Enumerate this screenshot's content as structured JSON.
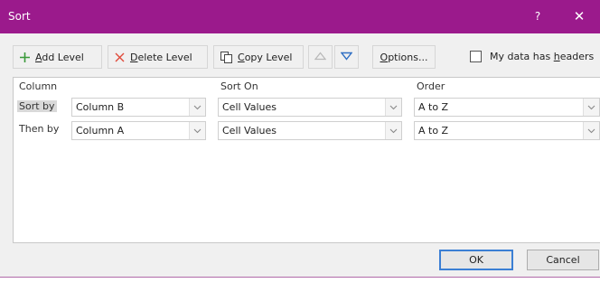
{
  "window": {
    "title": "Sort",
    "help_glyph": "?",
    "close_glyph": "✕",
    "titlebar_color": "#9b1a8c"
  },
  "toolbar": {
    "add_level": {
      "icon": "plus-icon",
      "pre": "",
      "key": "A",
      "post": "dd Level"
    },
    "delete_level": {
      "icon": "delete-x-icon",
      "pre": "",
      "key": "D",
      "post": "elete Level"
    },
    "copy_level": {
      "icon": "copy-icon",
      "pre": "",
      "key": "C",
      "post": "opy Level"
    },
    "move_up": {
      "icon": "triangle-up-icon"
    },
    "move_down": {
      "icon": "triangle-down-icon"
    },
    "options": {
      "pre": "",
      "key": "O",
      "post": "ptions..."
    },
    "my_data_has_headers": {
      "pre": "My data has ",
      "key": "h",
      "post": "eaders",
      "checked": false
    }
  },
  "grid": {
    "headers": {
      "column": "Column",
      "sort_on": "Sort On",
      "order": "Order"
    },
    "rows": [
      {
        "label": "Sort by",
        "column": "Column B",
        "sort_on": "Cell Values",
        "order": "A to Z",
        "selected": true
      },
      {
        "label": "Then by",
        "column": "Column A",
        "sort_on": "Cell Values",
        "order": "A to Z",
        "selected": false
      }
    ]
  },
  "buttons": {
    "ok": "OK",
    "cancel": "Cancel"
  }
}
